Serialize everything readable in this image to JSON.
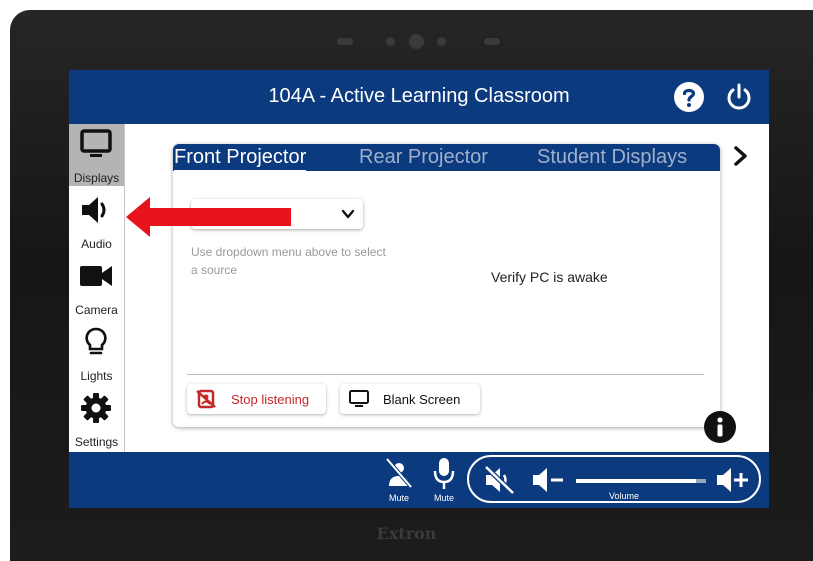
{
  "header": {
    "title": "104A - Active Learning Classroom"
  },
  "sidebar": {
    "items": [
      {
        "label": "Displays",
        "icon": "monitor-icon",
        "active": true
      },
      {
        "label": "Audio",
        "icon": "speaker-icon",
        "active": false
      },
      {
        "label": "Camera",
        "icon": "camera-icon",
        "active": false
      },
      {
        "label": "Lights",
        "icon": "lightbulb-icon",
        "active": false
      },
      {
        "label": "Settings",
        "icon": "gear-icon",
        "active": false
      }
    ]
  },
  "tabs": [
    "Front Projector",
    "Rear Projector",
    "Student Displays"
  ],
  "source": {
    "dropdown_value": "",
    "hint": "Use dropdown menu above to select a source"
  },
  "status": "Verify PC is awake",
  "buttons": {
    "stop_listening": "Stop listening",
    "blank_screen": "Blank Screen"
  },
  "footer": {
    "mute_room_label": "Mute",
    "mute_mic_label": "Mute",
    "volume_label": "Volume",
    "volume_level": 0.92
  },
  "device": {
    "brand": "Extron"
  },
  "colors": {
    "primary": "#0c3a7e",
    "sidebar_active": "#b4b4b4",
    "stop_red": "#c62828",
    "annotation_arrow": "#e8141b"
  }
}
